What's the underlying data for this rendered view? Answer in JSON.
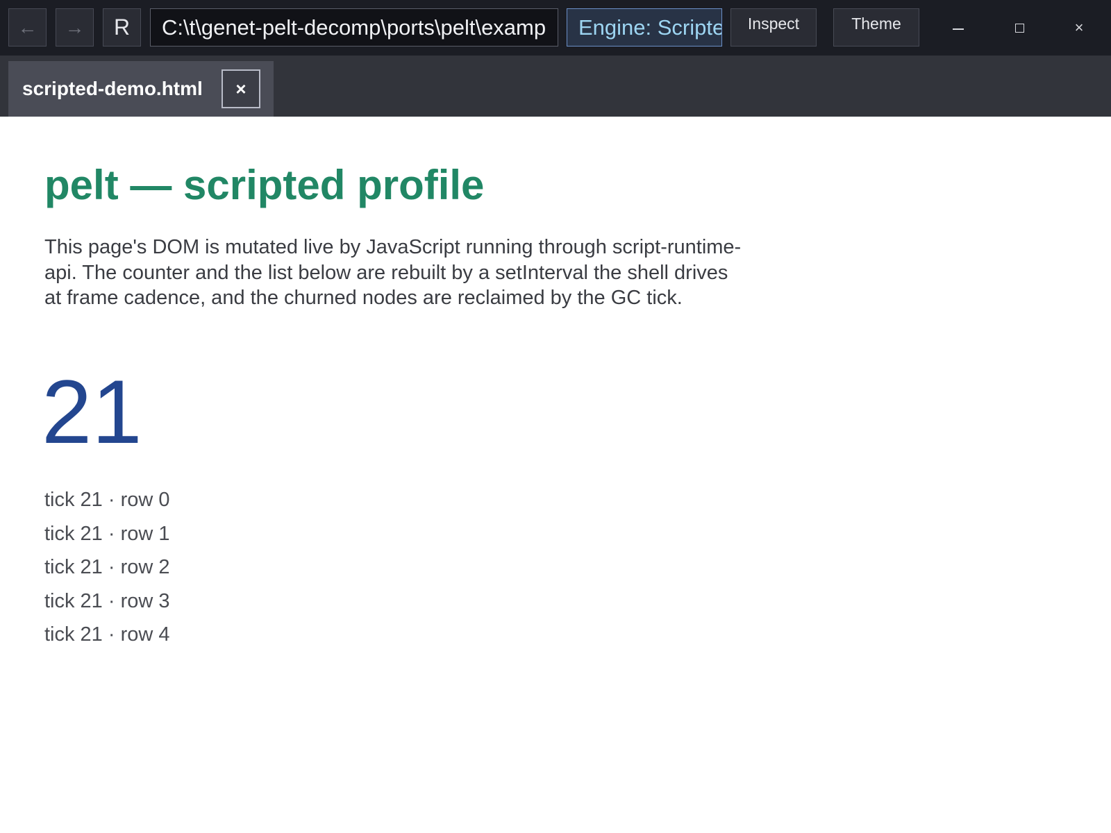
{
  "toolbar": {
    "back_label": "←",
    "forward_label": "→",
    "reload_label": "R",
    "address_value": "C:\\t\\genet-pelt-decomp\\ports\\pelt\\examp",
    "engine_label": "Engine: Scripte",
    "inspect_label": "Inspect",
    "theme_label": "Theme",
    "close_label": "×"
  },
  "tabs": [
    {
      "label": "scripted-demo.html",
      "close_label": "×"
    }
  ],
  "page": {
    "title": "pelt — scripted profile",
    "description": "This page's DOM is mutated live by JavaScript running through script-runtime-api. The counter and the list below are rebuilt by a setInterval the shell drives at frame cadence, and the churned nodes are reclaimed by the GC tick.",
    "counter": "21",
    "rows": [
      "tick 21 · row 0",
      "tick 21 · row 1",
      "tick 21 · row 2",
      "tick 21 · row 3",
      "tick 21 · row 4"
    ]
  },
  "colors": {
    "title": "#218765",
    "counter": "#23468f",
    "chrome": "#1b1d24",
    "engine_accent": "#9dd5f2"
  },
  "icons": {
    "back": "arrow-left-icon",
    "forward": "arrow-right-icon",
    "minimize": "minimize-icon",
    "maximize": "maximize-icon",
    "close": "close-icon"
  }
}
